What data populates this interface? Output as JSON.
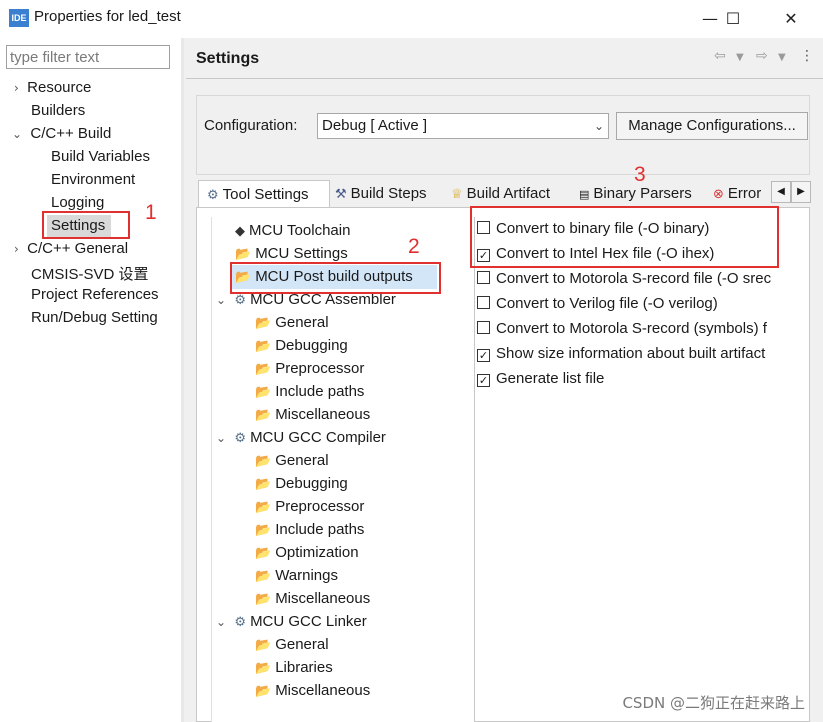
{
  "window": {
    "app_icon": "IDE",
    "title": "Properties for led_test",
    "minimize": "—",
    "maximize": "☐",
    "close": "✕"
  },
  "filter": {
    "placeholder": "type filter text"
  },
  "nav": {
    "resource": "Resource",
    "builders": "Builders",
    "cpp_build": "C/C++ Build",
    "build_variables": "Build Variables",
    "environment": "Environment",
    "logging": "Logging",
    "settings": "Settings",
    "cpp_general": "C/C++ General",
    "cmsis_svd": "CMSIS-SVD 设置",
    "project_references": "Project References",
    "run_debug": "Run/Debug Setting"
  },
  "header": {
    "title": "Settings"
  },
  "config": {
    "label": "Configuration:",
    "selected": "Debug  [ Active ]",
    "manage_button": "Manage Configurations..."
  },
  "tabs": [
    {
      "label": "Tool Settings",
      "icon": "gear-icon"
    },
    {
      "label": "Build Steps",
      "icon": "hammer-icon"
    },
    {
      "label": "Build Artifact",
      "icon": "trophy-icon"
    },
    {
      "label": "Binary Parsers",
      "icon": "binary-icon"
    },
    {
      "label": "Error",
      "icon": "error-icon"
    }
  ],
  "tree": {
    "mcu_toolchain": "MCU Toolchain",
    "mcu_settings": "MCU Settings",
    "mcu_post_build": "MCU Post build outputs",
    "assembler": "MCU GCC Assembler",
    "asm_general": "General",
    "asm_debugging": "Debugging",
    "asm_preprocessor": "Preprocessor",
    "asm_include": "Include paths",
    "asm_misc": "Miscellaneous",
    "compiler": "MCU GCC Compiler",
    "cc_general": "General",
    "cc_debugging": "Debugging",
    "cc_preprocessor": "Preprocessor",
    "cc_include": "Include paths",
    "cc_optimization": "Optimization",
    "cc_warnings": "Warnings",
    "cc_misc": "Miscellaneous",
    "linker": "MCU GCC Linker",
    "ld_general": "General",
    "ld_libraries": "Libraries",
    "ld_misc": "Miscellaneous"
  },
  "options": [
    {
      "label": "Convert to binary file (-O binary)",
      "checked": false
    },
    {
      "label": "Convert to Intel Hex file (-O ihex)",
      "checked": true
    },
    {
      "label": "Convert to Motorola S-record file (-O srec",
      "checked": false
    },
    {
      "label": "Convert to Verilog file (-O verilog)",
      "checked": false
    },
    {
      "label": "Convert to Motorola S-record (symbols) f",
      "checked": false
    },
    {
      "label": "Show size information about built artifact",
      "checked": true
    },
    {
      "label": "Generate list file",
      "checked": true
    }
  ],
  "annotations": {
    "n1": "1",
    "n2": "2",
    "n3": "3"
  },
  "watermark": "CSDN @二狗正在赶来路上",
  "colors": {
    "annotation": "#e03030",
    "selection": "#d3e6f8"
  }
}
